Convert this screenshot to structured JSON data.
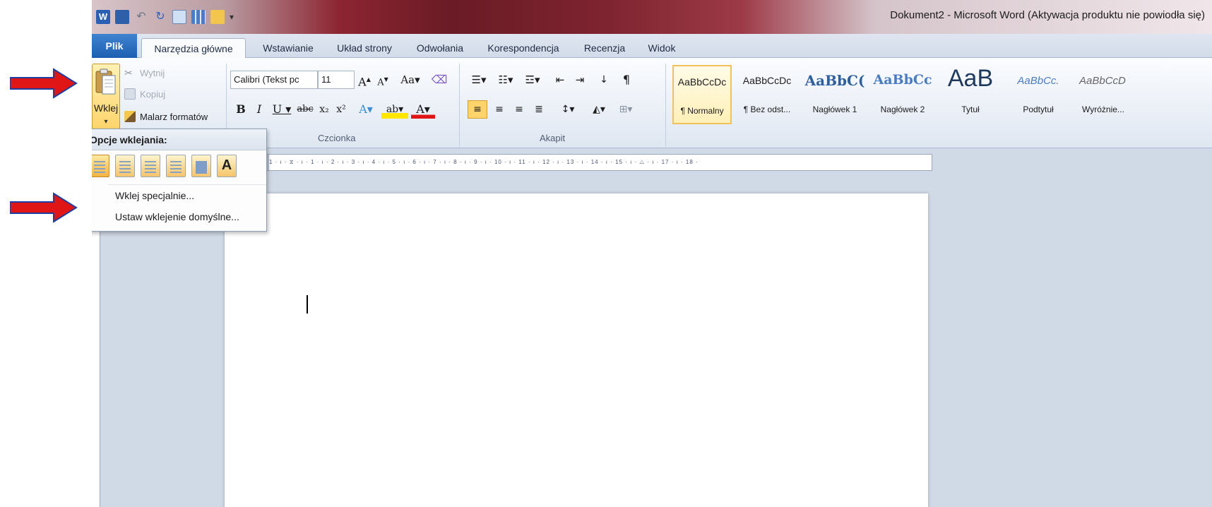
{
  "title_bar": {
    "title": "Dokument2 - Microsoft Word (Aktywacja produktu nie powiodła się)",
    "quick_access_icons": [
      "word-app-icon",
      "save-icon",
      "undo-icon",
      "redo-icon",
      "print-preview-icon",
      "table-icon",
      "open-folder-icon",
      "customize-toolbar-icon"
    ]
  },
  "tabs": [
    "Plik",
    "Narzędzia główne",
    "Wstawianie",
    "Układ strony",
    "Odwołania",
    "Korespondencja",
    "Recenzja",
    "Widok"
  ],
  "clipboard": {
    "paste_label": "Wklej",
    "cut_label": "Wytnij",
    "copy_label": "Kopiuj",
    "format_painter_label": "Malarz formatów"
  },
  "font": {
    "group_label": "Czcionka",
    "font_name": "Calibri (Tekst pc",
    "font_size": "11"
  },
  "paragraph": {
    "group_label": "Akapit"
  },
  "styles": [
    {
      "preview": "AaBbCcDc",
      "name": "¶ Normalny"
    },
    {
      "preview": "AaBbCcDc",
      "name": "¶ Bez odst..."
    },
    {
      "preview": "AaBbC(",
      "name": "Nagłówek 1"
    },
    {
      "preview": "AaBbCc",
      "name": "Nagłówek 2"
    },
    {
      "preview": "AaB",
      "name": "Tytuł"
    },
    {
      "preview": "AaBbCc.",
      "name": "Podtytuł"
    },
    {
      "preview": "AaBbCcD",
      "name": "Wyróżnie..."
    }
  ],
  "paste_menu": {
    "header": "Opcje wklejania:",
    "items": [
      "Wklej specjalnie...",
      "Ustaw wklejenie domyślne..."
    ]
  },
  "ruler_text": "1 · ı · ⧖ · ı · 1 · ı · 2 · ı · 3 · ı · 4 · ı · 5 · ı · 6 · ı · 7 · ı · 8 · ı · 9 · ı · 10 · ı · 11 · ı · 12 · ı · 13 · ı · 14 · ı · 15 · ı · △ · ı · 17 · ı · 18 ·",
  "colors": {
    "arrow": "#e01515",
    "file_tab": "#2a6cc0",
    "active_style_border": "#f1c25b"
  }
}
